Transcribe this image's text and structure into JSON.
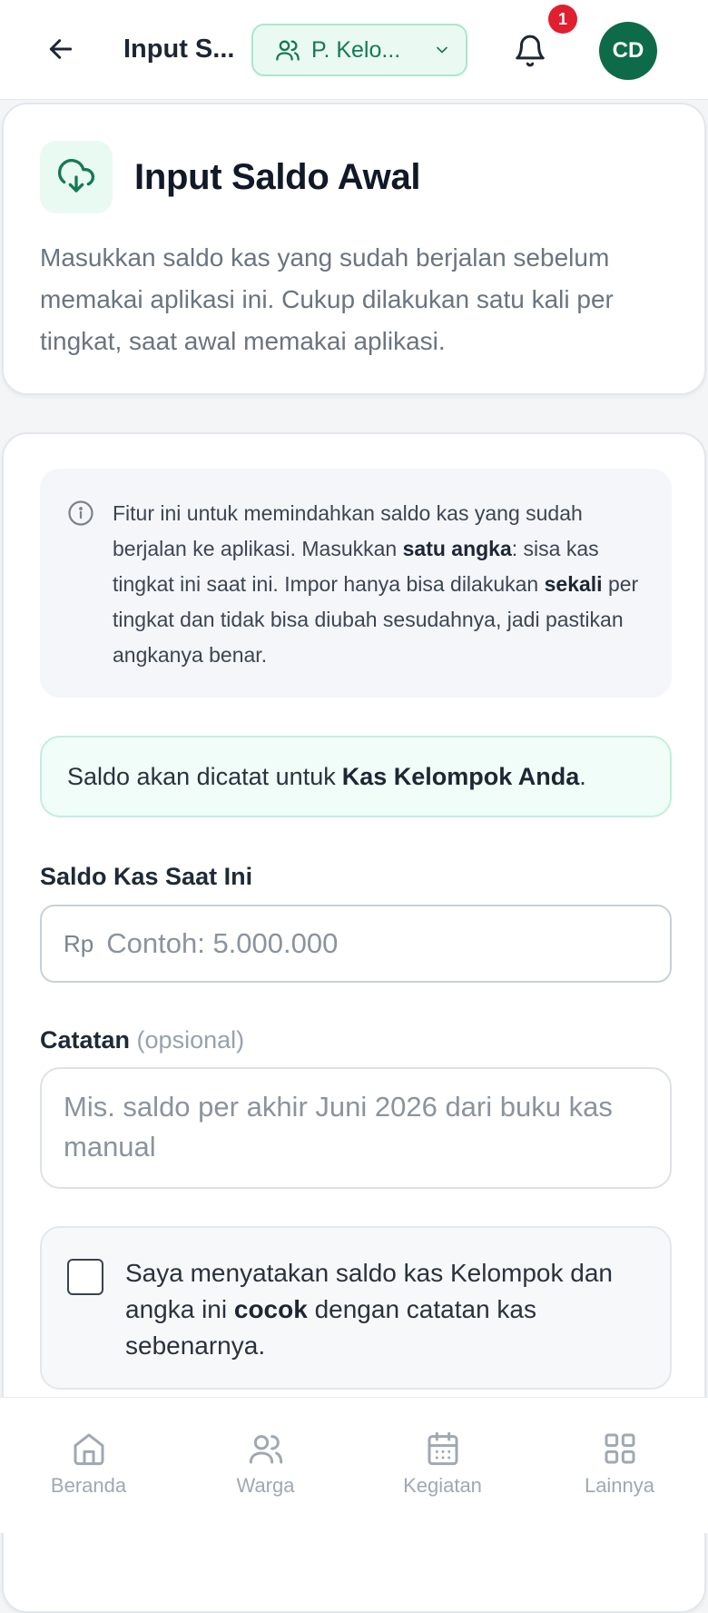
{
  "header": {
    "title": "Input S...",
    "group_selector": "P. Kelo...",
    "notification_count": "1",
    "avatar_initials": "CD"
  },
  "intro": {
    "title": "Input Saldo Awal",
    "description": "Masukkan saldo kas yang sudah berjalan sebelum memakai aplikasi ini. Cukup dilakukan satu kali per tingkat, saat awal memakai aplikasi."
  },
  "info": {
    "p1": "Fitur ini untuk memindahkan saldo kas yang sudah berjalan ke aplikasi. Masukkan ",
    "b1": "satu angka",
    "p2": ": sisa kas tingkat ini saat ini. Impor hanya bisa dilakukan ",
    "b2": "sekali",
    "p3": " per tingkat dan tidak bisa diubah sesudahnya, jadi pastikan angkanya benar."
  },
  "notice": {
    "text": "Saldo akan dicatat untuk",
    "bold": "Kas Kelompok Anda",
    "end": "."
  },
  "form": {
    "balance_label": "Saldo Kas Saat Ini",
    "currency_prefix": "Rp",
    "balance_placeholder": "Contoh: 5.000.000",
    "notes_label": "Catatan",
    "notes_optional": "(opsional)",
    "notes_placeholder": "Mis. saldo per akhir Juni 2026 dari buku kas manual",
    "confirm_p1": "Saya menyatakan saldo kas Kelompok dan angka ini ",
    "confirm_bold": "cocok",
    "confirm_p2": " dengan catatan kas sebenarnya."
  },
  "bottom_nav": {
    "home": "Beranda",
    "members": "Warga",
    "events": "Kegiatan",
    "more": "Lainnya"
  },
  "icons": {
    "back": "arrow-left-icon",
    "group": "users-icon",
    "dropdown": "chevron-down-icon",
    "bell": "bell-icon",
    "title": "cloud-download-icon",
    "info": "info-icon",
    "home": "home-icon",
    "members": "users-icon",
    "events": "calendar-icon",
    "more": "grid-icon"
  },
  "colors": {
    "brand_green": "#0d6b4a",
    "accent_green": "#137a55",
    "badge_red": "#e0202f",
    "muted_text": "#6b7480"
  }
}
